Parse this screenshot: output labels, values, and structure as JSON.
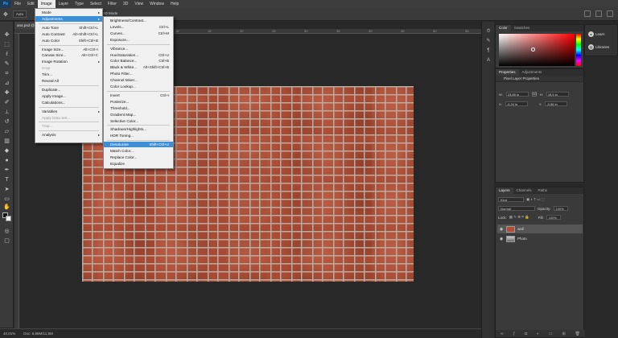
{
  "menubar": {
    "logo": "Ps",
    "items": [
      "File",
      "Edit",
      "Image",
      "Layer",
      "Type",
      "Select",
      "Filter",
      "3D",
      "View",
      "Window",
      "Help"
    ]
  },
  "options": {
    "tool_label": "Auto",
    "mode_label": "3D Mode"
  },
  "document": {
    "tab": "ana.psd @"
  },
  "ruler": [
    "10",
    "15",
    "20",
    "25",
    "30",
    "35",
    "40",
    "45",
    "50",
    "55"
  ],
  "image_menu": [
    {
      "label": "Mode",
      "arrow": "▸"
    },
    {
      "label": "Adjustments",
      "arrow": "▸",
      "highlight": true
    },
    {
      "label": "Auto Tone",
      "sc": "Shift+Ctrl+L"
    },
    {
      "label": "Auto Contrast",
      "sc": "Alt+Shift+Ctrl+L"
    },
    {
      "label": "Auto Color",
      "sc": "Shift+Ctrl+B"
    },
    {
      "label": "Image Size...",
      "sc": "Alt+Ctrl+I"
    },
    {
      "label": "Canvas Size...",
      "sc": "Alt+Ctrl+C"
    },
    {
      "label": "Image Rotation",
      "arrow": "▸"
    },
    {
      "label": "Crop",
      "disabled": true
    },
    {
      "label": "Trim..."
    },
    {
      "label": "Reveal All"
    },
    {
      "label": "Duplicate..."
    },
    {
      "label": "Apply Image..."
    },
    {
      "label": "Calculations..."
    },
    {
      "label": "Variables",
      "arrow": "▸"
    },
    {
      "label": "Apply Data Set...",
      "disabled": true
    },
    {
      "label": "Trap...",
      "disabled": true
    },
    {
      "label": "Analysis",
      "arrow": "▸"
    }
  ],
  "adjust_menu": [
    {
      "label": "Brightness/Contrast..."
    },
    {
      "label": "Levels...",
      "sc": "Ctrl+L"
    },
    {
      "label": "Curves...",
      "sc": "Ctrl+M"
    },
    {
      "label": "Exposure..."
    },
    {
      "label": "Vibrance..."
    },
    {
      "label": "Hue/Saturation...",
      "sc": "Ctrl+U"
    },
    {
      "label": "Color Balance...",
      "sc": "Ctrl+B"
    },
    {
      "label": "Black & White...",
      "sc": "Alt+Shift+Ctrl+B"
    },
    {
      "label": "Photo Filter..."
    },
    {
      "label": "Channel Mixer..."
    },
    {
      "label": "Color Lookup..."
    },
    {
      "label": "Invert",
      "sc": "Ctrl+I"
    },
    {
      "label": "Posterize..."
    },
    {
      "label": "Threshold..."
    },
    {
      "label": "Gradient Map..."
    },
    {
      "label": "Selective Color..."
    },
    {
      "label": "Shadows/Highlights..."
    },
    {
      "label": "HDR Toning..."
    },
    {
      "label": "Desaturate",
      "sc": "Shift+Ctrl+U",
      "highlight": true
    },
    {
      "label": "Match Color..."
    },
    {
      "label": "Replace Color..."
    },
    {
      "label": "Equalize"
    }
  ],
  "color_panel": {
    "tabs": [
      "Color",
      "Swatches"
    ]
  },
  "learn": {
    "items": [
      "Learn",
      "Libraries"
    ]
  },
  "properties": {
    "tabs": [
      "Properties",
      "Adjustments"
    ],
    "title": "Pixel Layer Properties",
    "w_label": "W:",
    "w_value": "23,85 in",
    "h_label": "H:",
    "h_value": "15,5 in",
    "x_label": "X:",
    "x_value": "-0,24 in",
    "y_label": "Y:",
    "y_value": "-0,56 in",
    "link": "GO"
  },
  "layers": {
    "tabs": [
      "Layers",
      "Channels",
      "Paths"
    ],
    "kind": "Kind",
    "blend": "Normal",
    "opacity_label": "Opacity:",
    "opacity_value": "100%",
    "lock_label": "Lock:",
    "fill_label": "Fill:",
    "fill_value": "100%",
    "list": [
      {
        "name": "wall",
        "selected": true
      },
      {
        "name": "Photo",
        "selected": false
      }
    ]
  },
  "status": {
    "zoom": "40,01%",
    "doc": "Doc: 6,86M/11,5M"
  }
}
